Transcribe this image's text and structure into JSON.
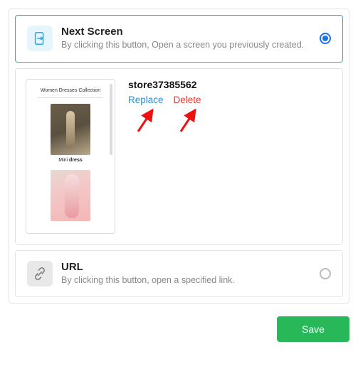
{
  "options": {
    "next_screen": {
      "title": "Next Screen",
      "desc": "By clicking this button, Open a screen you previously created."
    },
    "url": {
      "title": "URL",
      "desc": "By clicking this button, open a specified link."
    }
  },
  "screen": {
    "name": "store37385562",
    "replace_label": "Replace",
    "delete_label": "Delete"
  },
  "preview": {
    "heading": "Women Dresses Collection",
    "item1_caption_prefix": "Mini ",
    "item1_caption_bold": "dress"
  },
  "actions": {
    "save": "Save"
  },
  "colors": {
    "accent": "#2ea6e6",
    "radio": "#1a73e8",
    "save": "#28b85a",
    "replace": "#2a8fd4",
    "delete": "#e33b2e"
  }
}
